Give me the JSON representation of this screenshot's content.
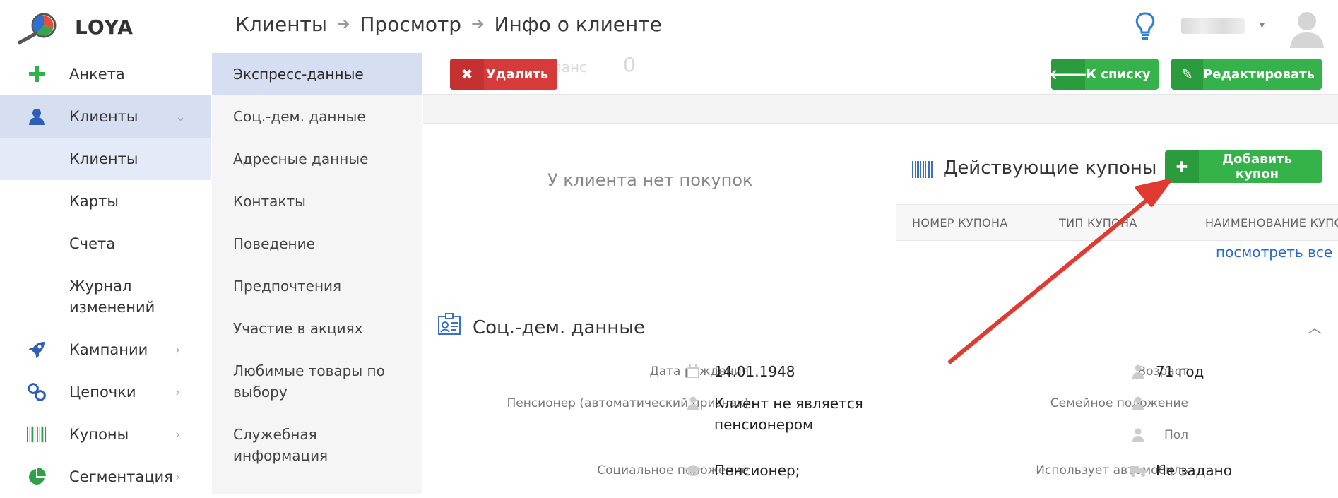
{
  "header": {
    "logo_text": "LOYA",
    "breadcrumb": [
      "Клиенты",
      "Просмотр",
      "Инфо о клиенте"
    ]
  },
  "sidebar": {
    "items": [
      {
        "label": "Анкета",
        "icon": "plus-icon"
      },
      {
        "label": "Клиенты",
        "icon": "user-icon",
        "expanded": true
      },
      {
        "label": "Клиенты",
        "sub": true,
        "active": true
      },
      {
        "label": "Карты",
        "sub": true
      },
      {
        "label": "Счета",
        "sub": true
      },
      {
        "label": "Журнал изменений",
        "sub": true
      },
      {
        "label": "Кампании",
        "icon": "rocket-icon"
      },
      {
        "label": "Цепочки",
        "icon": "link-icon"
      },
      {
        "label": "Купоны",
        "icon": "barcode-icon"
      },
      {
        "label": "Сегментация",
        "icon": "pie-chart-icon"
      }
    ]
  },
  "subnav": {
    "items": [
      "Экспресс-данные",
      "Соц.-дем. данные",
      "Адресные данные",
      "Контакты",
      "Поведение",
      "Предпочтения",
      "Участие в акциях",
      "Любимые товары по выбору",
      "Служебная информация"
    ],
    "active_index": 0
  },
  "toolbar": {
    "ghost_label": "Активный баланс",
    "ghost_value": "0",
    "delete_label": "Удалить",
    "back_label": "К списку",
    "edit_label": "Редактировать"
  },
  "purchases": {
    "empty_text": "У клиента нет покупок"
  },
  "coupons": {
    "title": "Действующие купоны",
    "add_label": "Добавить купон",
    "columns": [
      "НОМЕР КУПОНА",
      "ТИП КУПОНА",
      "НАИМЕНОВАНИЕ КУПО"
    ],
    "see_all": "посмотреть все"
  },
  "socdem": {
    "title": "Соц.-дем. данные",
    "left_fields": [
      {
        "label": "Дата рождения",
        "value": "14.01.1948",
        "icon": "calendar-icon"
      },
      {
        "label": "Пенсионер (автоматический признак)",
        "value": "Клиент не является пенсионером",
        "icon": "person-icon"
      },
      {
        "label": "Социальное положение",
        "value": "Пенсионер;",
        "icon": "graduation-cap-icon"
      }
    ],
    "right_fields": [
      {
        "label": "Возраст",
        "value": "71 год",
        "icon": "person-icon"
      },
      {
        "label": "Семейное положение",
        "value": "",
        "icon": "person-icon"
      },
      {
        "label": "Пол",
        "value": "",
        "icon": "person-icon"
      },
      {
        "label": "Использует автомобиль",
        "value": "Не задано",
        "icon": "truck-icon"
      }
    ]
  },
  "colors": {
    "green": "#35b34a",
    "red": "#d63a3a",
    "link": "#2a6bd1",
    "active_bg": "#d6dff2",
    "arrow": "#e03a31"
  }
}
